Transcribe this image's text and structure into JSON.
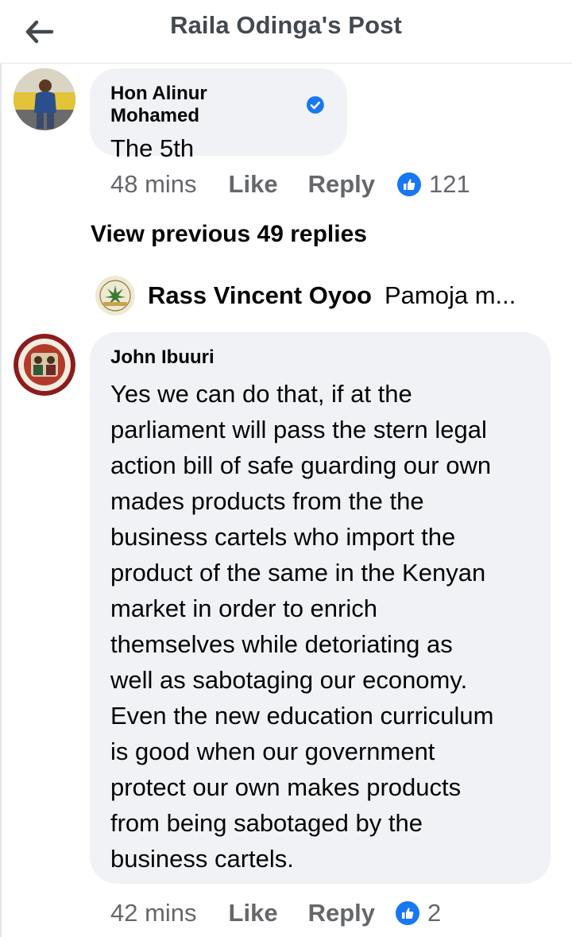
{
  "header": {
    "title": "Raila Odinga's Post"
  },
  "comment1": {
    "author": "Hon Alinur Mohamed",
    "text": "The 5th",
    "time": "48 mins",
    "like_label": "Like",
    "reply_label": "Reply",
    "reaction_count": "121"
  },
  "view_previous": "View previous 49 replies",
  "reply_preview": {
    "name": "Rass Vincent Oyoo",
    "snippet": "Pamoja m..."
  },
  "comment2": {
    "author": "John Ibuuri",
    "lines": [
      "Yes we can do that, if at the",
      "parliament will pass the stern legal",
      "action bill of safe guarding our own",
      "mades products from the the",
      "business cartels who import the",
      "product of the same in the Kenyan",
      "market in order to enrich",
      "themselves while detoriating as",
      "well as sabotaging our economy.",
      "Even the new education curriculum",
      "is good when our government",
      "protect our own makes products",
      "from being sabotaged by the",
      "business cartels."
    ],
    "time": "42 mins",
    "like_label": "Like",
    "reply_label": "Reply",
    "reaction_count": "2"
  },
  "colors": {
    "bubble": "#f0f2f5",
    "meta_gray": "#65676b",
    "accent_blue": "#1877f2"
  },
  "icons": {
    "back": "back-arrow-icon",
    "verified": "verified-badge-icon",
    "like": "thumbs-up-icon"
  }
}
